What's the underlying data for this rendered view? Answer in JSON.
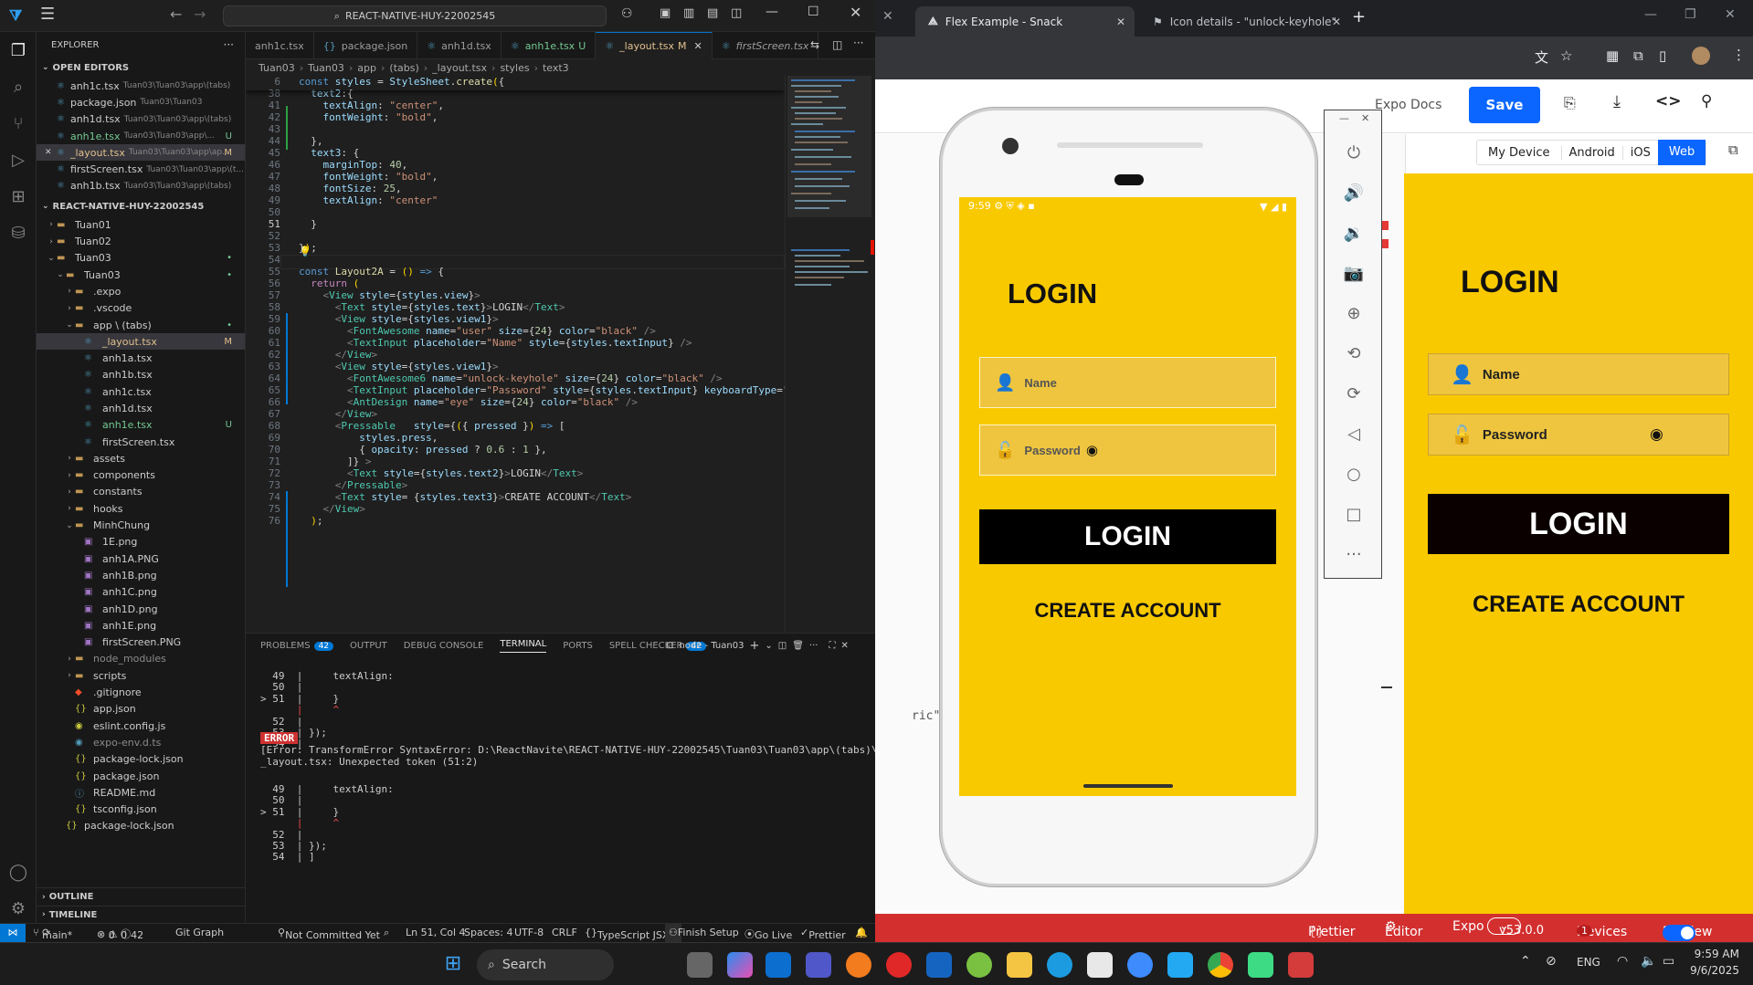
{
  "vscode": {
    "search_text": "REACT-NATIVE-HUY-22002545",
    "explorer_title": "EXPLORER",
    "open_editors_title": "OPEN EDITORS",
    "open_editors": [
      {
        "name": "anh1c.tsx",
        "path": "Tuan03\\Tuan03\\app\\(tabs)",
        "badge": ""
      },
      {
        "name": "package.json",
        "path": "Tuan03\\Tuan03",
        "badge": ""
      },
      {
        "name": "anh1d.tsx",
        "path": "Tuan03\\Tuan03\\app\\(tabs)",
        "badge": ""
      },
      {
        "name": "anh1e.tsx",
        "path": "Tuan03\\Tuan03\\app\\...",
        "badge": "U"
      },
      {
        "name": "_layout.tsx",
        "path": "Tuan03\\Tuan03\\app\\ap...",
        "badge": "M"
      },
      {
        "name": "firstScreen.tsx",
        "path": "Tuan03\\Tuan03\\app\\(t...",
        "badge": ""
      },
      {
        "name": "anh1b.tsx",
        "path": "Tuan03\\Tuan03\\app\\(tabs)",
        "badge": ""
      }
    ],
    "project_title": "REACT-NATIVE-HUY-22002545",
    "tree": [
      {
        "name": "Tuan01",
        "depth": 1,
        "type": "folder",
        "badge": ""
      },
      {
        "name": "Tuan02",
        "depth": 1,
        "type": "folder",
        "badge": ""
      },
      {
        "name": "Tuan03",
        "depth": 1,
        "type": "folder-open",
        "badge": "•"
      },
      {
        "name": "Tuan03",
        "depth": 2,
        "type": "folder-open",
        "badge": "•"
      },
      {
        "name": ".expo",
        "depth": 3,
        "type": "folder",
        "badge": ""
      },
      {
        "name": ".vscode",
        "depth": 3,
        "type": "folder",
        "badge": ""
      },
      {
        "name": "app \\ (tabs)",
        "depth": 3,
        "type": "folder-open",
        "badge": "•"
      },
      {
        "name": "_layout.tsx",
        "depth": 4,
        "type": "tsx",
        "badge": "M"
      },
      {
        "name": "anh1a.tsx",
        "depth": 4,
        "type": "tsx",
        "badge": ""
      },
      {
        "name": "anh1b.tsx",
        "depth": 4,
        "type": "tsx",
        "badge": ""
      },
      {
        "name": "anh1c.tsx",
        "depth": 4,
        "type": "tsx",
        "badge": ""
      },
      {
        "name": "anh1d.tsx",
        "depth": 4,
        "type": "tsx",
        "badge": ""
      },
      {
        "name": "anh1e.tsx",
        "depth": 4,
        "type": "tsx",
        "badge": "U"
      },
      {
        "name": "firstScreen.tsx",
        "depth": 4,
        "type": "tsx",
        "badge": ""
      },
      {
        "name": "assets",
        "depth": 3,
        "type": "folder",
        "badge": ""
      },
      {
        "name": "components",
        "depth": 3,
        "type": "folder",
        "badge": ""
      },
      {
        "name": "constants",
        "depth": 3,
        "type": "folder",
        "badge": ""
      },
      {
        "name": "hooks",
        "depth": 3,
        "type": "folder",
        "badge": ""
      },
      {
        "name": "MinhChung",
        "depth": 3,
        "type": "folder-open",
        "badge": ""
      },
      {
        "name": "1E.png",
        "depth": 4,
        "type": "img",
        "badge": ""
      },
      {
        "name": "anh1A.PNG",
        "depth": 4,
        "type": "img",
        "badge": ""
      },
      {
        "name": "anh1B.png",
        "depth": 4,
        "type": "img",
        "badge": ""
      },
      {
        "name": "anh1C.png",
        "depth": 4,
        "type": "img",
        "badge": ""
      },
      {
        "name": "anh1D.png",
        "depth": 4,
        "type": "img",
        "badge": ""
      },
      {
        "name": "anh1E.png",
        "depth": 4,
        "type": "img",
        "badge": ""
      },
      {
        "name": "firstScreen.PNG",
        "depth": 4,
        "type": "img",
        "badge": ""
      },
      {
        "name": "node_modules",
        "depth": 3,
        "type": "folder",
        "badge": ""
      },
      {
        "name": "scripts",
        "depth": 3,
        "type": "folder",
        "badge": ""
      },
      {
        "name": ".gitignore",
        "depth": 3,
        "type": "git",
        "badge": ""
      },
      {
        "name": "app.json",
        "depth": 3,
        "type": "json",
        "badge": ""
      },
      {
        "name": "eslint.config.js",
        "depth": 3,
        "type": "js",
        "badge": ""
      },
      {
        "name": "expo-env.d.ts",
        "depth": 3,
        "type": "ts",
        "badge": ""
      },
      {
        "name": "package-lock.json",
        "depth": 3,
        "type": "json",
        "badge": ""
      },
      {
        "name": "package.json",
        "depth": 3,
        "type": "json",
        "badge": ""
      },
      {
        "name": "README.md",
        "depth": 3,
        "type": "md",
        "badge": ""
      },
      {
        "name": "tsconfig.json",
        "depth": 3,
        "type": "json",
        "badge": ""
      },
      {
        "name": "package-lock.json",
        "depth": 2,
        "type": "json",
        "badge": ""
      }
    ],
    "outline_title": "OUTLINE",
    "timeline_title": "TIMELINE",
    "tabs": [
      {
        "label": "anh1c.tsx",
        "badge": "",
        "active": false
      },
      {
        "label": "package.json",
        "badge": "",
        "active": false
      },
      {
        "label": "anh1d.tsx",
        "badge": "",
        "active": false
      },
      {
        "label": "anh1e.tsx",
        "badge": "U",
        "active": false
      },
      {
        "label": "_layout.tsx",
        "badge": "M",
        "active": true
      },
      {
        "label": "firstScreen.tsx",
        "badge": "",
        "active": false
      }
    ],
    "breadcrumbs": [
      "Tuan03",
      "Tuan03",
      "app",
      "(tabs)",
      "_layout.tsx",
      "styles",
      "text3"
    ],
    "code_lines": [
      {
        "n": "6",
        "html": "<span class='kw'>const</span> <span class='prop'>styles</span> = <span class='prop'>StyleSheet</span>.<span class='fn'>create</span><span class='brk'>(</span>{"
      },
      {
        "n": "38",
        "html": "  <span class='prop'>text2</span>:{"
      },
      {
        "n": "41",
        "html": "    <span class='prop'>textAlign</span>: <span class='str'>\"center\"</span>,"
      },
      {
        "n": "42",
        "html": "    <span class='prop'>fontWeight</span>: <span class='str'>\"bold\"</span>,"
      },
      {
        "n": "43",
        "html": ""
      },
      {
        "n": "44",
        "html": "  },"
      },
      {
        "n": "45",
        "html": "  <span class='prop'>text3</span>: {"
      },
      {
        "n": "46",
        "html": "    <span class='prop'>marginTop</span>: <span class='num'>40</span>,"
      },
      {
        "n": "47",
        "html": "    <span class='prop'>fontWeight</span>: <span class='str'>\"bold\"</span>,"
      },
      {
        "n": "48",
        "html": "    <span class='prop'>fontSize</span>: <span class='num'>25</span>,"
      },
      {
        "n": "49",
        "html": "    <span class='prop'>textAlign</span>: <span class='str'>\"center\"</span>"
      },
      {
        "n": "50",
        "html": ""
      },
      {
        "n": "51",
        "html": "  }"
      },
      {
        "n": "52",
        "html": ""
      },
      {
        "n": "53",
        "html": "}<span class='brk'>)</span>;"
      },
      {
        "n": "54",
        "html": ""
      },
      {
        "n": "55",
        "html": "<span class='kw'>const</span> <span class='fn'>Layout2A</span> = <span class='brk'>()</span> <span class='kw'>=&gt;</span> {"
      },
      {
        "n": "56",
        "html": "  <span class='ctl'>return</span> <span class='brk'>(</span>"
      },
      {
        "n": "57",
        "html": "    <span class='pun'>&lt;</span><span class='tag'>View</span> <span class='prop'>style</span>={<span class='prop'>styles</span>.<span class='prop'>view</span>}<span class='pun'>&gt;</span>"
      },
      {
        "n": "58",
        "html": "      <span class='pun'>&lt;</span><span class='tag'>Text</span> <span class='prop'>style</span>={<span class='prop'>styles</span>.<span class='prop'>text</span>}<span class='pun'>&gt;</span>LOGIN<span class='pun'>&lt;/</span><span class='tag'>Text</span><span class='pun'>&gt;</span>"
      },
      {
        "n": "59",
        "html": "      <span class='pun'>&lt;</span><span class='tag'>View</span> <span class='prop'>style</span>={<span class='prop'>styles</span>.<span class='prop'>view1</span>}<span class='pun'>&gt;</span>"
      },
      {
        "n": "60",
        "html": "        <span class='pun'>&lt;</span><span class='tag'>FontAwesome</span> <span class='prop'>name</span>=<span class='str'>\"user\"</span> <span class='prop'>size</span>={<span class='num'>24</span>} <span class='prop'>color</span>=<span class='str'>\"black\"</span> <span class='pun'>/&gt;</span>"
      },
      {
        "n": "61",
        "html": "        <span class='pun'>&lt;</span><span class='tag'>TextInput</span> <span class='prop'>placeholder</span>=<span class='str'>\"Name\"</span> <span class='prop'>style</span>={<span class='prop'>styles</span>.<span class='prop'>textInput</span>} <span class='pun'>/&gt;</span>"
      },
      {
        "n": "62",
        "html": "      <span class='pun'>&lt;/</span><span class='tag'>View</span><span class='pun'>&gt;</span>"
      },
      {
        "n": "63",
        "html": "      <span class='pun'>&lt;</span><span class='tag'>View</span> <span class='prop'>style</span>={<span class='prop'>styles</span>.<span class='prop'>view1</span>}<span class='pun'>&gt;</span>"
      },
      {
        "n": "64",
        "html": "        <span class='pun'>&lt;</span><span class='tag'>FontAwesome6</span> <span class='prop'>name</span>=<span class='str'>\"unlock-keyhole\"</span> <span class='prop'>size</span>={<span class='num'>24</span>} <span class='prop'>color</span>=<span class='str'>\"black\"</span> <span class='pun'>/&gt;</span>"
      },
      {
        "n": "65",
        "html": "        <span class='pun'>&lt;</span><span class='tag'>TextInput</span> <span class='prop'>placeholder</span>=<span class='str'>\"Password\"</span> <span class='prop'>style</span>={<span class='prop'>styles</span>.<span class='prop'>textInput</span>} <span class='prop'>keyboardType</span>=<span class='str'>\"nu</span>"
      },
      {
        "n": "66",
        "html": "        <span class='pun'>&lt;</span><span class='tag'>AntDesign</span> <span class='prop'>name</span>=<span class='str'>\"eye\"</span> <span class='prop'>size</span>={<span class='num'>24</span>} <span class='prop'>color</span>=<span class='str'>\"black\"</span> <span class='pun'>/&gt;</span>"
      },
      {
        "n": "67",
        "html": "      <span class='pun'>&lt;/</span><span class='tag'>View</span><span class='pun'>&gt;</span>"
      },
      {
        "n": "68",
        "html": "      <span class='pun'>&lt;</span><span class='tag'>Pressable</span>   <span class='prop'>style</span>={<span class='brk'>(</span>{ <span class='prop'>pressed</span> }<span class='brk'>)</span> <span class='kw'>=&gt;</span> ["
      },
      {
        "n": "69",
        "html": "          <span class='prop'>styles</span>.<span class='prop'>press</span>,"
      },
      {
        "n": "70",
        "html": "          { <span class='prop'>opacity</span>: <span class='prop'>pressed</span> ? <span class='num'>0.6</span> : <span class='num'>1</span> },"
      },
      {
        "n": "71",
        "html": "        ]} <span class='pun'>&gt;</span>"
      },
      {
        "n": "72",
        "html": "        <span class='pun'>&lt;</span><span class='tag'>Text</span> <span class='prop'>style</span>={<span class='prop'>styles</span>.<span class='prop'>text2</span>}<span class='pun'>&gt;</span>LOGIN<span class='pun'>&lt;/</span><span class='tag'>Text</span><span class='pun'>&gt;</span>"
      },
      {
        "n": "73",
        "html": "      <span class='pun'>&lt;/</span><span class='tag'>Pressable</span><span class='pun'>&gt;</span>"
      },
      {
        "n": "74",
        "html": "      <span class='pun'>&lt;</span><span class='tag'>Text</span> <span class='prop'>style</span>= {<span class='prop'>styles</span>.<span class='prop'>text3</span>}<span class='pun'>&gt;</span>CREATE ACCOUNT<span class='pun'>&lt;/</span><span class='tag'>Text</span><span class='pun'>&gt;</span>"
      },
      {
        "n": "75",
        "html": "    <span class='pun'>&lt;/</span><span class='tag'>View</span><span class='pun'>&gt;</span>"
      },
      {
        "n": "76",
        "html": "  <span class='brk'>)</span>;"
      }
    ],
    "panel_tabs": [
      {
        "label": "PROBLEMS",
        "badge": "42"
      },
      {
        "label": "OUTPUT",
        "badge": ""
      },
      {
        "label": "DEBUG CONSOLE",
        "badge": ""
      },
      {
        "label": "TERMINAL",
        "badge": ""
      },
      {
        "label": "PORTS",
        "badge": ""
      },
      {
        "label": "SPELL CHECKER",
        "badge": "42"
      }
    ],
    "terminal_name": "node - Tuan03",
    "terminal_lines": [
      {
        "t": "  49  |     textAlign:",
        "c": ""
      },
      {
        "t": "  50  |",
        "c": ""
      },
      {
        "t": "> 51  |     }",
        "c": "err"
      },
      {
        "t": "      |     ^",
        "c": "caret"
      },
      {
        "t": "  52  |",
        "c": ""
      },
      {
        "t": "  53  | });",
        "c": ""
      },
      {
        "t": "  54  |",
        "c": ""
      }
    ],
    "error_label": "ERROR",
    "error_text": "[Error: TransformError SyntaxError: D:\\ReactNavite\\REACT-NATIVE-HUY-22002545\\Tuan03\\Tuan03\\app\\(tabs)\\",
    "error_text2": "_layout.tsx: Unexpected token (51:2)",
    "terminal_lines2": [
      {
        "t": "  49  |     textAlign:",
        "c": ""
      },
      {
        "t": "  50  |",
        "c": ""
      },
      {
        "t": "> 51  |     }",
        "c": "err"
      },
      {
        "t": "      |     ^",
        "c": "caret"
      },
      {
        "t": "  52  |",
        "c": ""
      },
      {
        "t": "  53  | });",
        "c": ""
      },
      {
        "t": "  54  | ]",
        "c": ""
      }
    ],
    "status": {
      "branch": "main*",
      "errors": "0",
      "warnings": "0",
      "infos": "42",
      "git_graph": "Git Graph",
      "not_committed": "Not Committed Yet",
      "position": "Ln 51, Col 4",
      "spaces": "Spaces: 4",
      "encoding": "UTF-8",
      "eol": "CRLF",
      "language": "TypeScript JSX",
      "finish_setup": "Finish Setup",
      "go_live": "Go Live",
      "prettier": "Prettier"
    }
  },
  "chrome": {
    "tabs": [
      {
        "label": "Flex Example - Snack",
        "active": true
      },
      {
        "label": "Icon details - \"unlock-keyhole\"",
        "active": false
      }
    ],
    "expo_docs": "Expo Docs",
    "save_label": "Save",
    "device_tabs": [
      "My Device",
      "Android",
      "iOS",
      "Web"
    ],
    "active_device": "Web",
    "code_peek": "ric\" maxL",
    "bottom": {
      "prettier": "Prettier",
      "editor": "Editor",
      "expo": "Expo",
      "version": "v53.0.0",
      "devices": "Devices",
      "devices_count": "1",
      "preview": "Preview"
    }
  },
  "phone": {
    "time": "9:59",
    "title": "LOGIN",
    "name_placeholder": "Name",
    "password_placeholder": "Password",
    "button_label": "LOGIN",
    "create_account": "CREATE ACCOUNT"
  },
  "web_preview": {
    "title": "LOGIN",
    "name_placeholder": "Name",
    "password_placeholder": "Password",
    "button_label": "LOGIN",
    "create_account": "CREATE ACCOUNT"
  },
  "taskbar": {
    "search_label": "Search",
    "lang": "ENG",
    "time": "9:59 AM",
    "date": "9/6/2025"
  },
  "colors": {
    "app_yellow": "#f9c900",
    "vscode_blue": "#0078d4",
    "expo_red": "#d32f2f",
    "save_blue": "#0a66ff"
  }
}
